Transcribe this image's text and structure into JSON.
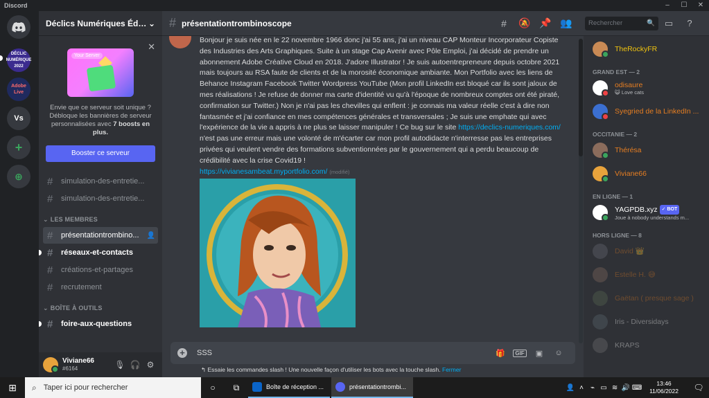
{
  "window": {
    "app_title": "Discord",
    "min": "–",
    "max": "☐",
    "close": "✕"
  },
  "rail": {
    "home_label": "",
    "servers": [
      {
        "label": "DÉCLIC NUMÉRIQUE 2022",
        "color": "#3b2b8f"
      },
      {
        "label": "Adobe Live",
        "color": "#1f2a5e"
      },
      {
        "label": "Vs",
        "color": "#36393f"
      }
    ],
    "add_label": "+",
    "explore_label": "⊕"
  },
  "guild": {
    "name": "Déclics Numériques Édit...",
    "chevron": "⌄"
  },
  "boost": {
    "art_label": "Your Server",
    "text_1": "Envie que ce serveur soit unique ? Débloque les bannières de serveur personnalisées avec ",
    "text_bold": "7 boosts en plus.",
    "button": "Booster ce serveur",
    "close": "✕"
  },
  "channels": {
    "top": [
      {
        "label": "simulation-des-entretie..."
      },
      {
        "label": "simulation-des-entretie..."
      }
    ],
    "cat_members": "LES MEMBRES",
    "members_ch": [
      {
        "label": "présentationtrombino..."
      },
      {
        "label": "réseaux-et-contacts"
      },
      {
        "label": "créations-et-partages"
      },
      {
        "label": "recrutement"
      }
    ],
    "cat_tools": "BOÎTE À OUTILS",
    "tools_ch": [
      {
        "label": "foire-aux-questions"
      }
    ]
  },
  "user_panel": {
    "name": "Viviane66",
    "tag": "#6164"
  },
  "chat": {
    "channel": "présentationtrombinoscope",
    "message_text": "Bonjour je suis née en le 22 novembre 1966 donc j'ai 55 ans, j'ai un niveau CAP Monteur Incorporateur Copiste des Industries des Arts Graphiques. Suite à un stage Cap Avenir avec Pôle Emploi, j'ai décidé de prendre un abonnement Adobe Créative Cloud en 2018. J'adore Illustrator ! Je suis autoentrepreneure depuis octobre 2021 mais toujours au RSA faute de clients et de la morosité économique ambiante. Mon Portfolio avec les liens de Behance Instagram Facebook Twitter Wordpress YouTube (Mon profil LinkedIn est bloqué car ils sont jaloux de mes réalisations ! Je refuse de donner ma carte d'identité vu qu'à l'époque de nombreux comptes ont été piraté, confirmation sur Twitter.) Non je n'ai pas les chevilles qui enflent : je connais ma valeur réelle c'est à dire non fantasmée et j'ai confiance en mes compétences générales et transversales ; Je suis une emphate qui avec l'expérience de la vie a appris à ne plus se laisser manipuler ! Ce bug sur le site ",
    "link_1": "https://declics-numeriques.com/",
    "message_text_2": " n'est pas une erreur mais une volonté de m'écarter car mon profil autodidacte n'interresse pas les entreprises privées qui veulent vendre des formations subventionnées par le gouvernement qui a perdu beaucoup de crédibilité avec la crise Covid19 !",
    "link_2": "https://vivianesambeat.myportfolio.com/",
    "edited": "(modifié)",
    "composer_value": "SSS",
    "gif_label": "GIF",
    "slash_tip": "Essaie les commandes slash ! Une nouvelle façon d'utiliser les bots avec la touche slash.",
    "slash_close": "Fermer"
  },
  "members_panel": {
    "search_placeholder": "Rechercher",
    "top_member": {
      "name": "TheRockyFR",
      "color": "#f1c40f"
    },
    "groups": [
      {
        "title": "GRAND EST — 2",
        "members": [
          {
            "name": "odisaure",
            "sub": "😺 Love cats",
            "color": "#e67e22",
            "status": "dnd",
            "av": "#ffffff"
          },
          {
            "name": "Syegried de la LinkedIn ...",
            "sub": "",
            "color": "#e67e22",
            "status": "dnd",
            "av": "#3b6fd1"
          }
        ]
      },
      {
        "title": "OCCITANIE — 2",
        "members": [
          {
            "name": "Thérésa",
            "sub": "",
            "color": "#e67e22",
            "status": "online",
            "av": "#8b6c5c"
          },
          {
            "name": "Viviane66",
            "sub": "",
            "color": "#e67e22",
            "status": "online",
            "av": "#e8a33c"
          }
        ]
      },
      {
        "title": "EN LIGNE — 1",
        "members": [
          {
            "name": "YAGPDB.xyz",
            "sub": "Joue à nobody understands m...",
            "color": "#ffffff",
            "status": "online",
            "av": "#ffffff",
            "bot": "✓ BOT"
          }
        ]
      },
      {
        "title": "HORS LIGNE — 8",
        "members": [
          {
            "name": "David 👑",
            "sub": "",
            "color": "#e67e22",
            "status": "off",
            "av": "#6d6f78"
          },
          {
            "name": "Estelle H. 😅",
            "sub": "",
            "color": "#e67e22",
            "status": "off",
            "av": "#8a6f63"
          },
          {
            "name": "Gaëtan ( presque sage )",
            "sub": "",
            "color": "#e67e22",
            "status": "off",
            "av": "#5a6b55"
          },
          {
            "name": "Iris - Diversidays",
            "sub": "",
            "color": "#ffffff",
            "status": "off",
            "av": "#5d6a72"
          },
          {
            "name": "KRAPS",
            "sub": "",
            "color": "#ffffff",
            "status": "off",
            "av": "#757575"
          }
        ]
      }
    ]
  },
  "taskbar": {
    "search_placeholder": "Taper ici pour rechercher",
    "apps": [
      {
        "label": "Boîte de réception ...",
        "color": "#0a64c8"
      },
      {
        "label": "présentationtrombi...",
        "color": "#5865f2"
      }
    ],
    "time": "13:46",
    "date": "11/06/2022"
  },
  "colors": {
    "accent": "#5865f2",
    "link": "#00aff4",
    "online": "#3ba55d",
    "dnd": "#ed4245"
  }
}
